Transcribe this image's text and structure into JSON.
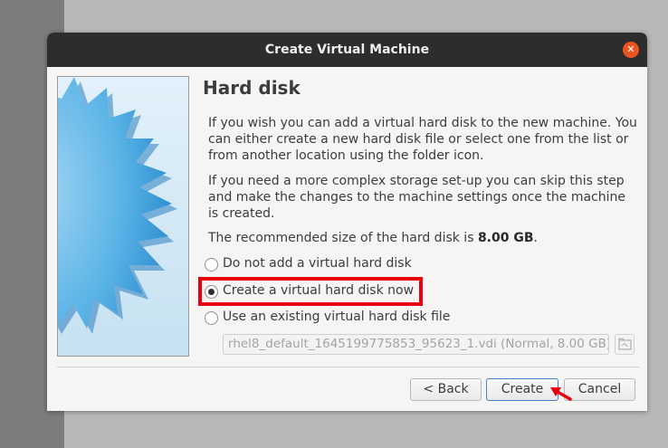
{
  "dialog": {
    "title": "Create Virtual Machine",
    "close_icon": "close-icon",
    "heading": "Hard disk",
    "paragraph1": "If you wish you can add a virtual hard disk to the new machine. You can either create a new hard disk file or select one from the list or from another location using the folder icon.",
    "paragraph2": "If you need a more complex storage set-up you can skip this step and make the changes to the machine settings once the machine is created.",
    "recommended_prefix": "The recommended size of the hard disk is ",
    "recommended_size": "8.00 GB",
    "recommended_suffix": ".",
    "options": [
      {
        "label": "Do not add a virtual hard disk",
        "checked": false
      },
      {
        "label": "Create a virtual hard disk now",
        "checked": true
      },
      {
        "label": "Use an existing virtual hard disk file",
        "checked": false
      }
    ],
    "existing_disk_value": "rhel8_default_1645199775853_95623_1.vdi (Normal, 8.00 GB)",
    "folder_icon": "folder-icon",
    "buttons": {
      "back": "< Back",
      "create": "Create",
      "cancel": "Cancel"
    },
    "colors": {
      "titlebar": "#2d2d2d",
      "close": "#e95420",
      "highlight": "#e8000f",
      "default_button_border": "#3f80d0"
    }
  }
}
